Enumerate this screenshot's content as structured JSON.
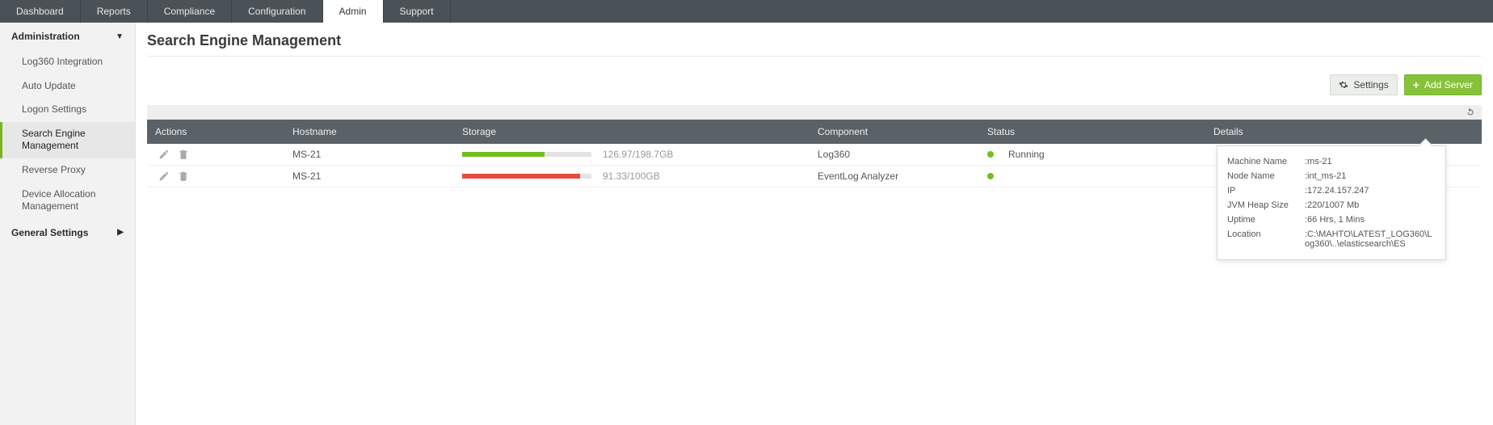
{
  "topnav": {
    "tabs": [
      "Dashboard",
      "Reports",
      "Compliance",
      "Configuration",
      "Admin",
      "Support"
    ],
    "active": 4
  },
  "sidebar": {
    "sections": [
      {
        "title": "Administration",
        "caret": "down",
        "items": [
          "Log360 Integration",
          "Auto Update",
          "Logon Settings",
          "Search Engine Management",
          "Reverse Proxy",
          "Device Allocation Management"
        ],
        "active": 3
      },
      {
        "title": "General Settings",
        "caret": "right",
        "items": []
      }
    ]
  },
  "page": {
    "title": "Search Engine Management",
    "settings_label": "Settings",
    "add_server_label": "Add Server"
  },
  "table": {
    "headers": {
      "actions": "Actions",
      "hostname": "Hostname",
      "storage": "Storage",
      "component": "Component",
      "status": "Status",
      "details": "Details"
    },
    "rows": [
      {
        "hostname": "MS-21",
        "storage_text": "126.97/198.7GB",
        "storage_pct": 64,
        "storage_color": "green",
        "component": "Log360",
        "status_color": "green",
        "status_text": "Running",
        "details_label": "Details"
      },
      {
        "hostname": "MS-21",
        "storage_text": "91.33/100GB",
        "storage_pct": 91,
        "storage_color": "red",
        "component": "EventLog Analyzer",
        "status_color": "green",
        "status_text": "",
        "details_label": ""
      }
    ]
  },
  "popover": {
    "rows": [
      {
        "label": "Machine Name",
        "value": ":ms-21"
      },
      {
        "label": "Node Name",
        "value": ":int_ms-21"
      },
      {
        "label": "IP",
        "value": ":172.24.157.247"
      },
      {
        "label": "JVM Heap Size",
        "value": ":220/1007 Mb"
      },
      {
        "label": "Uptime",
        "value": ":66 Hrs, 1 Mins"
      },
      {
        "label": "Location",
        "value": ":C:\\MAHTO\\LATEST_LOG360\\Log360\\..\\elasticsearch\\ES"
      }
    ]
  }
}
